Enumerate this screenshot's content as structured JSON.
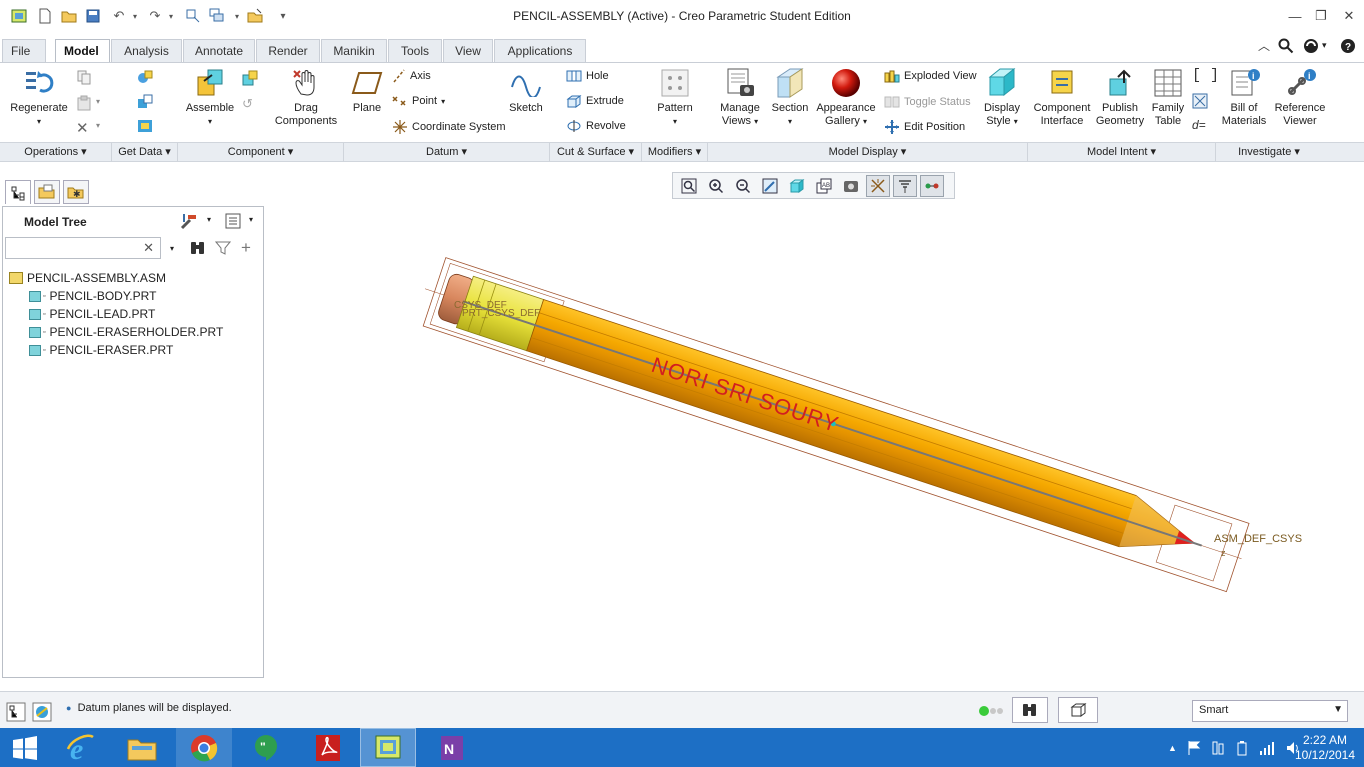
{
  "window": {
    "title": "PENCIL-ASSEMBLY (Active) - Creo Parametric Student Edition"
  },
  "tabs": [
    {
      "label": "File",
      "dropdown": true
    },
    {
      "label": "Model",
      "active": true
    },
    {
      "label": "Analysis"
    },
    {
      "label": "Annotate"
    },
    {
      "label": "Render"
    },
    {
      "label": "Manikin"
    },
    {
      "label": "Tools"
    },
    {
      "label": "View"
    },
    {
      "label": "Applications"
    }
  ],
  "ribbon": {
    "regenerate": "Regenerate",
    "assemble": "Assemble",
    "drag_components_1": "Drag",
    "drag_components_2": "Components",
    "plane": "Plane",
    "axis": "Axis",
    "point": "Point",
    "coordinate_system": "Coordinate System",
    "sketch": "Sketch",
    "hole": "Hole",
    "extrude": "Extrude",
    "revolve": "Revolve",
    "pattern": "Pattern",
    "manage_views_1": "Manage",
    "manage_views_2": "Views",
    "section": "Section",
    "appearance_gallery_1": "Appearance",
    "appearance_gallery_2": "Gallery",
    "exploded_view": "Exploded View",
    "toggle_status": "Toggle Status",
    "edit_position": "Edit Position",
    "display_style_1": "Display",
    "display_style_2": "Style",
    "component_interface_1": "Component",
    "component_interface_2": "Interface",
    "publish_geometry_1": "Publish",
    "publish_geometry_2": "Geometry",
    "family_table_1": "Family",
    "family_table_2": "Table",
    "bill_of_materials_1": "Bill of",
    "bill_of_materials_2": "Materials",
    "reference_viewer_1": "Reference",
    "reference_viewer_2": "Viewer"
  },
  "groups": [
    {
      "label": "Operations"
    },
    {
      "label": "Get Data"
    },
    {
      "label": "Component"
    },
    {
      "label": "Datum"
    },
    {
      "label": "Cut & Surface"
    },
    {
      "label": "Modifiers"
    },
    {
      "label": "Model Display"
    },
    {
      "label": "Model Intent"
    },
    {
      "label": "Investigate"
    }
  ],
  "model_tree": {
    "title": "Model Tree",
    "search_value": "",
    "root": "PENCIL-ASSEMBLY.ASM",
    "items": [
      "PENCIL-BODY.PRT",
      "PENCIL-LEAD.PRT",
      "PENCIL-ERASERHOLDER.PRT",
      "PENCIL-ERASER.PRT"
    ]
  },
  "graphics": {
    "engraving": "NORI SRI SOURY",
    "csys_label_1": "CSYS_DEF",
    "csys_label_2": "PRT_CSYS_DEF",
    "asm_csys_label": "ASM_DEF_CSYS",
    "axis_z": "z",
    "pencil_color": "#f5a800"
  },
  "status": {
    "message": "Datum planes will be displayed.",
    "filter_value": "Smart"
  },
  "taskbar": {
    "time": "2:22 AM",
    "date": "10/12/2014"
  }
}
